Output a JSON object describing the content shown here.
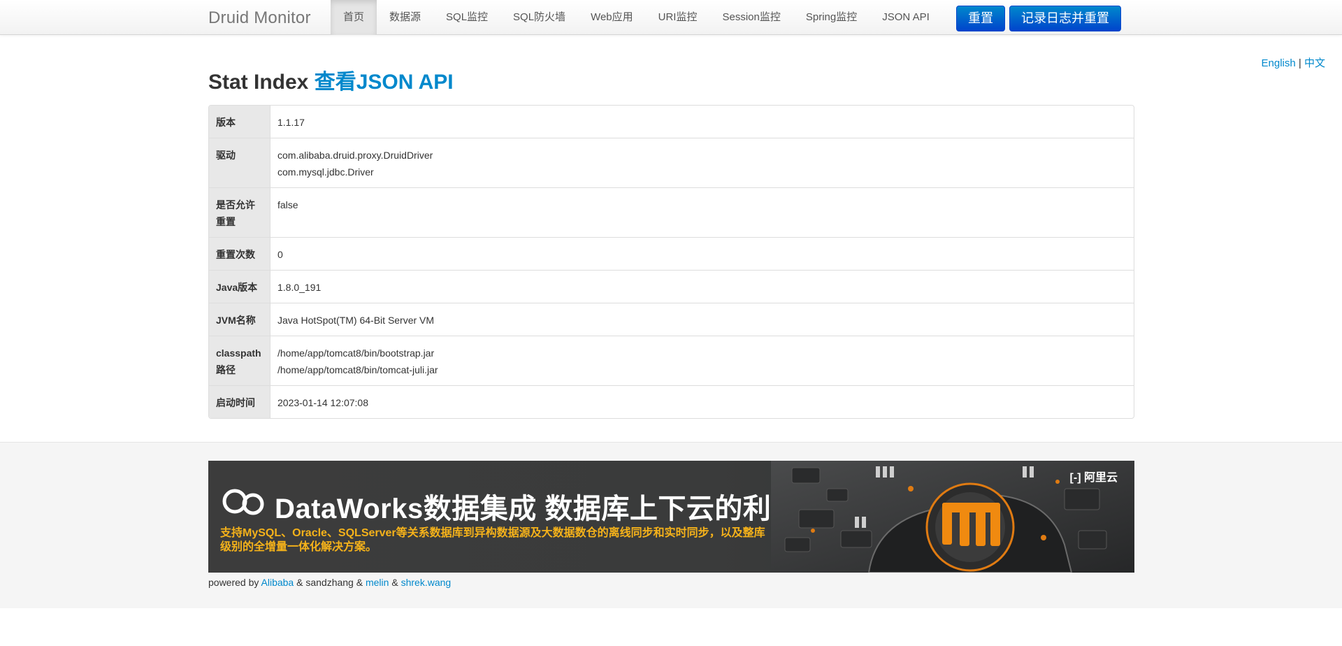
{
  "navbar": {
    "brand": "Druid Monitor",
    "items": [
      {
        "label": "首页",
        "active": true
      },
      {
        "label": "数据源"
      },
      {
        "label": "SQL监控"
      },
      {
        "label": "SQL防火墙"
      },
      {
        "label": "Web应用"
      },
      {
        "label": "URI监控"
      },
      {
        "label": "Session监控"
      },
      {
        "label": "Spring监控"
      },
      {
        "label": "JSON API"
      }
    ],
    "reset_label": "重置",
    "log_reset_label": "记录日志并重置"
  },
  "lang": {
    "english": "English",
    "separator": "|",
    "chinese": "中文"
  },
  "title": {
    "prefix": "Stat Index",
    "link": "查看JSON API"
  },
  "stats": [
    {
      "label": "版本",
      "values": [
        "1.1.17"
      ]
    },
    {
      "label": "驱动",
      "values": [
        "com.alibaba.druid.proxy.DruidDriver",
        "com.mysql.jdbc.Driver"
      ]
    },
    {
      "label": "是否允许重置",
      "values": [
        "false"
      ]
    },
    {
      "label": "重置次数",
      "values": [
        "0"
      ]
    },
    {
      "label": "Java版本",
      "values": [
        "1.8.0_191"
      ]
    },
    {
      "label": "JVM名称",
      "values": [
        "Java HotSpot(TM) 64-Bit Server VM"
      ]
    },
    {
      "label": "classpath路径",
      "values": [
        "/home/app/tomcat8/bin/bootstrap.jar",
        "/home/app/tomcat8/bin/tomcat-juli.jar"
      ]
    },
    {
      "label": "启动时间",
      "values": [
        "2023-01-14 12:07:08"
      ]
    }
  ],
  "banner": {
    "heading": "DataWorks数据集成 数据库上下云的利器",
    "subtitle": "支持MySQL、Oracle、SQLServer等关系数据库到异构数据源及大数据数仓的离线同步和实时同步，以及整库级别的全增量一体化解决方案。",
    "brand": "阿里云",
    "colors": {
      "accent": "#f5b21a",
      "background": "#3c3c3c"
    }
  },
  "footer": {
    "powered_by": "powered by",
    "alibaba": "Alibaba",
    "amp1": "&",
    "sandzhang": "sandzhang",
    "amp2": "&",
    "melin": "melin",
    "amp3": "&",
    "shrek": "shrek.wang"
  },
  "colors": {
    "link": "#0088cc",
    "primary_button": "#0044cc",
    "label_bg": "#e8e8e8"
  }
}
